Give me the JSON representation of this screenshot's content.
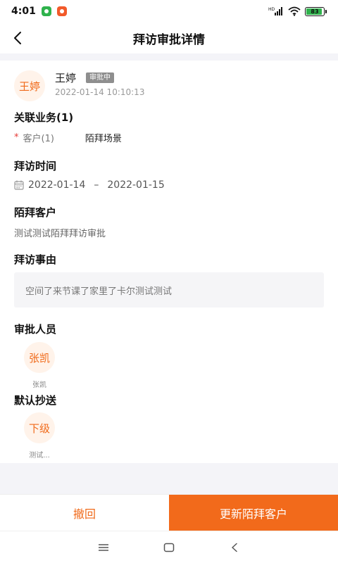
{
  "status_bar": {
    "time": "4:01",
    "battery": "83",
    "battery_level": 0.83,
    "network_label": "HD"
  },
  "header": {
    "title": "拜访审批详情",
    "back_icon": "chevron-left-icon"
  },
  "applicant": {
    "avatar_text": "王婷",
    "name": "王婷",
    "status": "审批中",
    "time": "2022-01-14 10:10:13"
  },
  "related_business": {
    "title": "关联业务(1)",
    "required_mark": "*",
    "label": "客户(1)",
    "value": "陌拜场景"
  },
  "visit_time": {
    "title": "拜访时间",
    "start": "2022-01-14",
    "separator": "–",
    "end": "2022-01-15"
  },
  "cold_customer": {
    "title": "陌拜客户",
    "value": "测试测试陌拜拜访审批"
  },
  "visit_reason": {
    "title": "拜访事由",
    "value": "空间了来节课了家里了卡尔测试测试"
  },
  "approvers": {
    "title": "审批人员",
    "items": [
      {
        "avatar_text": "张凯",
        "name": "张凯"
      }
    ]
  },
  "cc": {
    "title": "默认抄送",
    "items": [
      {
        "avatar_text": "下级",
        "name": "测试..."
      }
    ]
  },
  "actions": {
    "revoke": "撤回",
    "update": "更新陌拜客户"
  },
  "colors": {
    "accent": "#f26a1b",
    "avatar_bg": "#fff3ea",
    "badge_bg": "#8e8e8e"
  }
}
